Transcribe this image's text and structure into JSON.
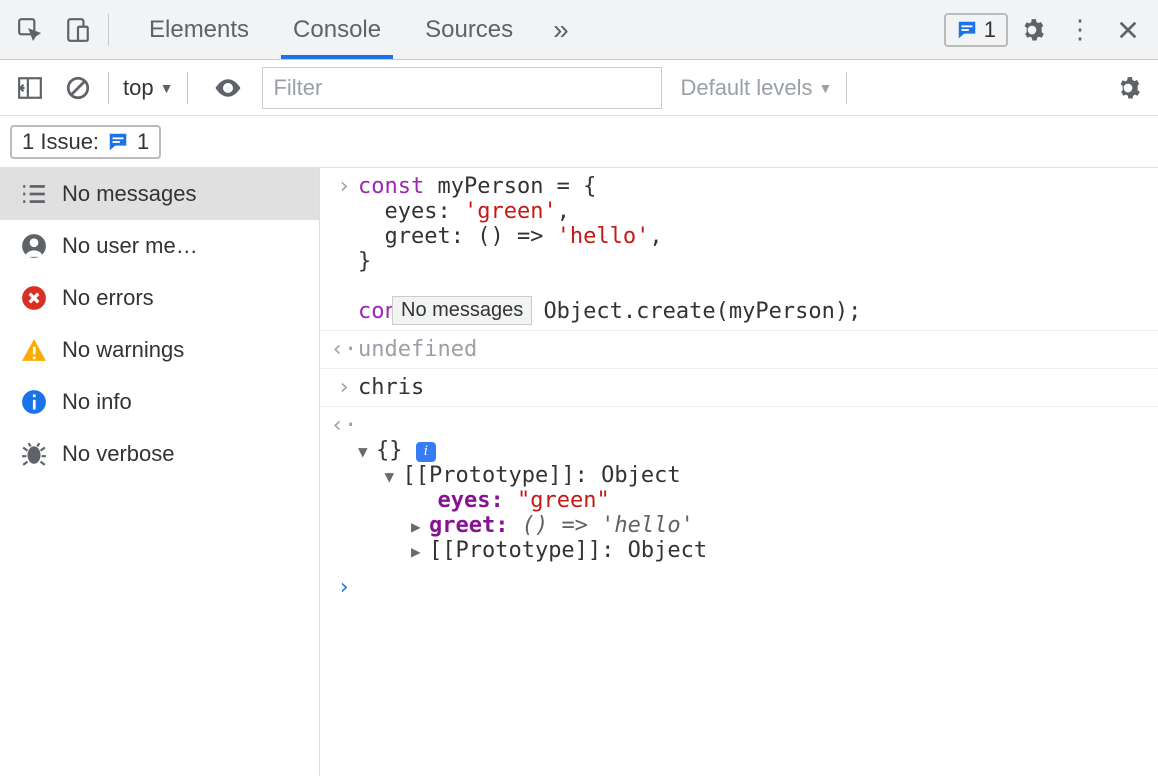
{
  "topbar": {
    "tabs": [
      "Elements",
      "Console",
      "Sources"
    ],
    "active_tab": 1,
    "issue_count": "1"
  },
  "toolbar": {
    "context": "top",
    "filter_placeholder": "Filter",
    "levels_label": "Default levels"
  },
  "issues": {
    "label_prefix": "1 Issue:",
    "count": "1"
  },
  "sidebar": {
    "items": [
      {
        "icon": "list",
        "label": "No messages",
        "selected": true
      },
      {
        "icon": "user",
        "label": "No user me…",
        "selected": false
      },
      {
        "icon": "error",
        "label": "No errors",
        "selected": false
      },
      {
        "icon": "warn",
        "label": "No warnings",
        "selected": false
      },
      {
        "icon": "info",
        "label": "No info",
        "selected": false
      },
      {
        "icon": "bug",
        "label": "No verbose",
        "selected": false
      }
    ]
  },
  "tooltip_text": "No messages",
  "console": {
    "input1_lines": [
      {
        "t": "const",
        "c": "kw"
      },
      {
        "t": " myPerson = {\n  eyes: ",
        "c": ""
      },
      {
        "t": "'green'",
        "c": "str"
      },
      {
        "t": ",\n  greet: () => ",
        "c": ""
      },
      {
        "t": "'hello'",
        "c": "str"
      },
      {
        "t": ",\n}\n\n",
        "c": ""
      },
      {
        "t": "const",
        "c": "kw"
      },
      {
        "t": " chris = Object.create(myPerson);",
        "c": ""
      }
    ],
    "result1": "undefined",
    "input2": "chris",
    "expand": {
      "head": "{}",
      "proto1": "[[Prototype]]: Object",
      "eyes_key": "eyes: ",
      "eyes_val": "\"green\"",
      "greet_key": "greet: ",
      "greet_val": "() => 'hello'",
      "proto2": "[[Prototype]]: Object"
    }
  }
}
